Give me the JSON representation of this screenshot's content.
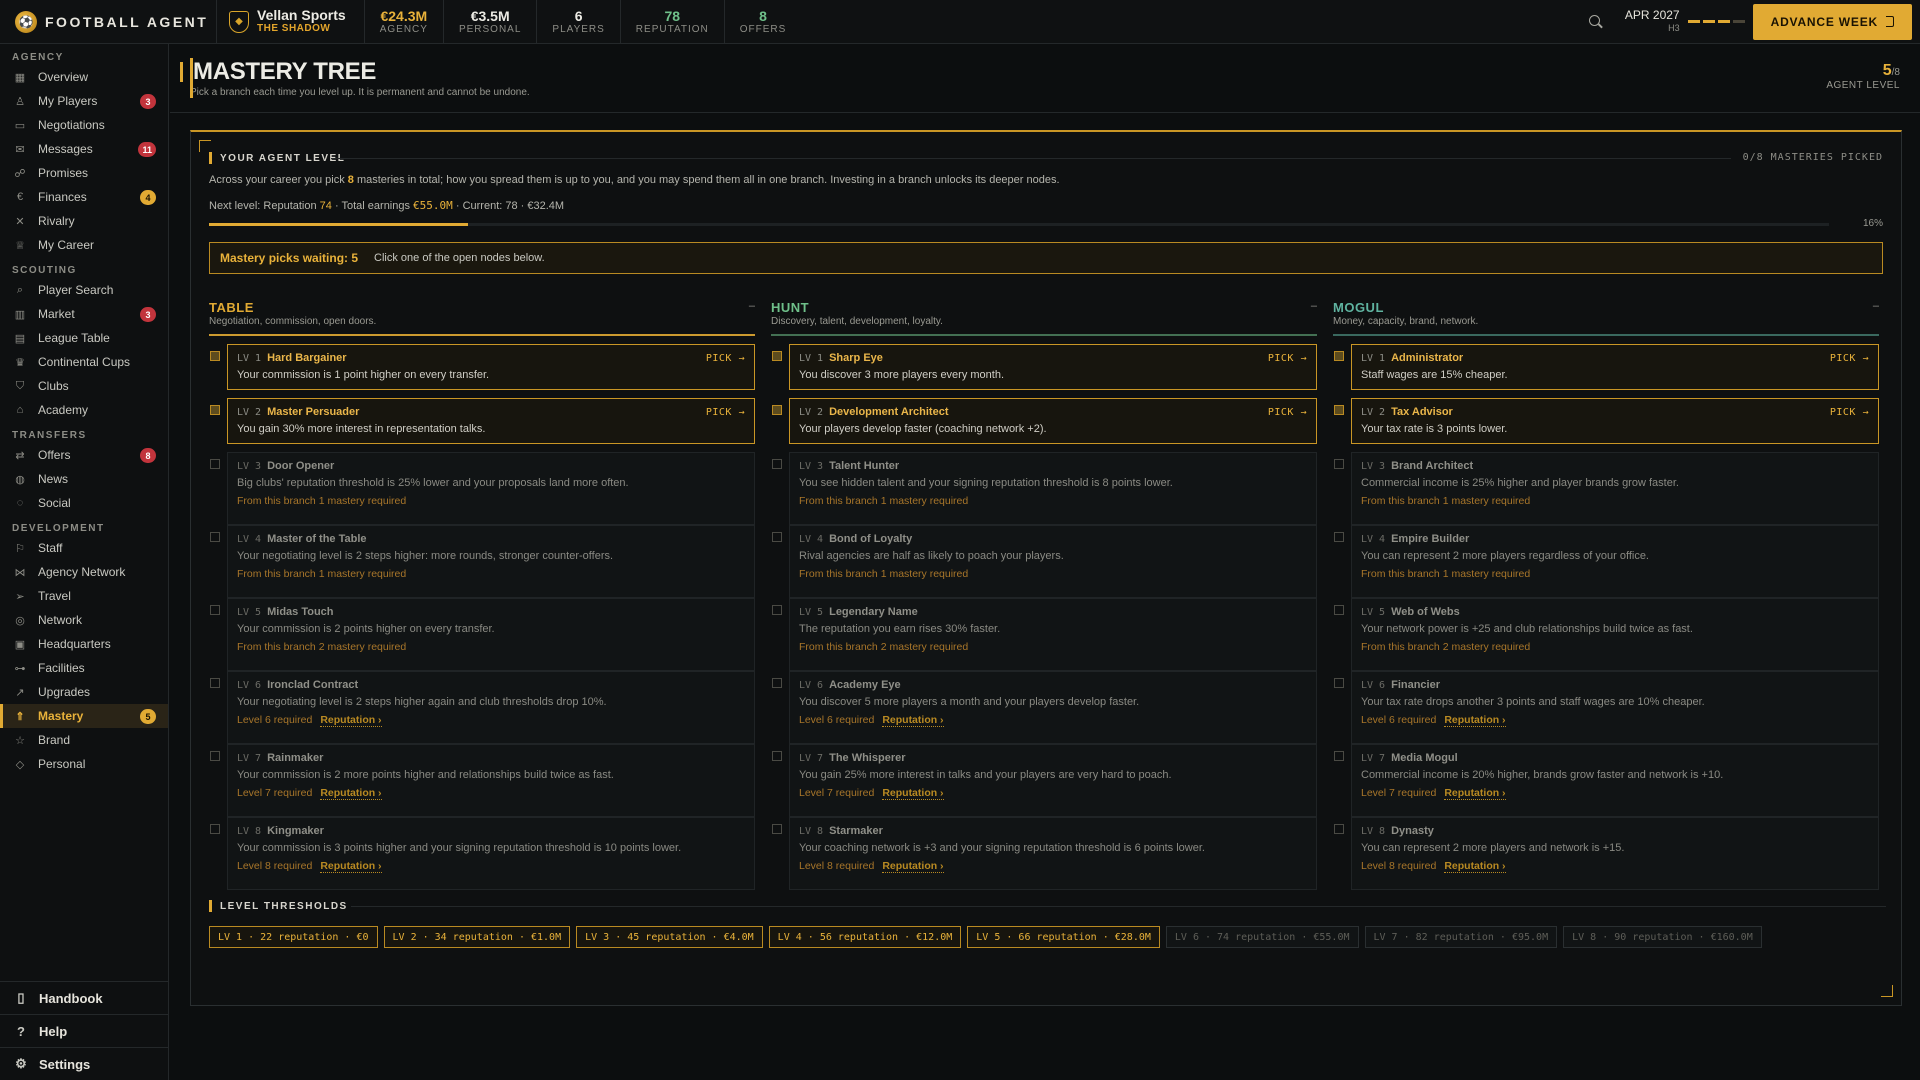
{
  "app": {
    "logo_mark": "⚽",
    "name": "FOOTBALL AGENT"
  },
  "club": {
    "name": "Vellan Sports",
    "subtitle": "THE SHADOW"
  },
  "stats": [
    {
      "value": "€24.3M",
      "label": "AGENCY",
      "color": "gold"
    },
    {
      "value": "€3.5M",
      "label": "PERSONAL",
      "color": "white"
    },
    {
      "value": "6",
      "label": "PLAYERS",
      "color": "white"
    },
    {
      "value": "78",
      "label": "REPUTATION",
      "color": "green"
    },
    {
      "value": "8",
      "label": "OFFERS",
      "color": "green"
    }
  ],
  "date": {
    "main": "APR 2027",
    "sub": "H3"
  },
  "advance_label": "ADVANCE WEEK",
  "sidebar": {
    "sections": [
      {
        "title": "AGENCY",
        "items": [
          {
            "label": "Overview",
            "icon": "grid-icon",
            "glyph": "▦"
          },
          {
            "label": "My Players",
            "icon": "user-icon",
            "glyph": "♙",
            "badge": "3"
          },
          {
            "label": "Negotiations",
            "icon": "chat-icon",
            "glyph": "▭"
          },
          {
            "label": "Messages",
            "icon": "mail-icon",
            "glyph": "✉",
            "badge": "11"
          },
          {
            "label": "Promises",
            "icon": "handshake-icon",
            "glyph": "☍"
          },
          {
            "label": "Finances",
            "icon": "euro-icon",
            "glyph": "€",
            "badge": "4",
            "badge_style": "y"
          },
          {
            "label": "Rivalry",
            "icon": "swords-icon",
            "glyph": "✕"
          },
          {
            "label": "My Career",
            "icon": "medal-icon",
            "glyph": "♕"
          }
        ]
      },
      {
        "title": "SCOUTING",
        "items": [
          {
            "label": "Player Search",
            "icon": "search-icon",
            "glyph": "⌕"
          },
          {
            "label": "Market",
            "icon": "bar-chart-icon",
            "glyph": "▥",
            "badge": "3"
          },
          {
            "label": "League Table",
            "icon": "table-icon",
            "glyph": "▤"
          },
          {
            "label": "Continental Cups",
            "icon": "trophy-icon",
            "glyph": "♛"
          },
          {
            "label": "Clubs",
            "icon": "shield-icon",
            "glyph": "⛉"
          },
          {
            "label": "Academy",
            "icon": "graduation-icon",
            "glyph": "⌂"
          }
        ]
      },
      {
        "title": "TRANSFERS",
        "items": [
          {
            "label": "Offers",
            "icon": "transfer-icon",
            "glyph": "⇄",
            "badge": "8"
          },
          {
            "label": "News",
            "icon": "globe-icon",
            "glyph": "◍"
          },
          {
            "label": "Social",
            "icon": "social-icon",
            "glyph": "◌"
          }
        ]
      },
      {
        "title": "DEVELOPMENT",
        "items": [
          {
            "label": "Staff",
            "icon": "whistle-icon",
            "glyph": "⚐"
          },
          {
            "label": "Agency Network",
            "icon": "network-icon",
            "glyph": "⋈"
          },
          {
            "label": "Travel",
            "icon": "plane-icon",
            "glyph": "➢"
          },
          {
            "label": "Network",
            "icon": "globe-icon",
            "glyph": "◎"
          },
          {
            "label": "Headquarters",
            "icon": "building-icon",
            "glyph": "▣"
          },
          {
            "label": "Facilities",
            "icon": "dumbbell-icon",
            "glyph": "⊶"
          },
          {
            "label": "Upgrades",
            "icon": "trend-up-icon",
            "glyph": "↗"
          },
          {
            "label": "Mastery",
            "icon": "chevrons-up-icon",
            "glyph": "⇑",
            "badge": "5",
            "badge_style": "y",
            "active": true
          },
          {
            "label": "Brand",
            "icon": "star-icon",
            "glyph": "☆"
          },
          {
            "label": "Personal",
            "icon": "gem-icon",
            "glyph": "◇"
          }
        ]
      }
    ],
    "bottom": [
      {
        "label": "Handbook",
        "icon": "book-icon",
        "glyph": "▯"
      },
      {
        "label": "Help",
        "icon": "help-icon",
        "glyph": "?"
      },
      {
        "label": "Settings",
        "icon": "gear-icon",
        "glyph": "⚙"
      }
    ]
  },
  "page": {
    "title": "MASTERY TREE",
    "subtitle": "Pick a branch each time you level up. It is permanent and cannot be undone.",
    "level_num": "5",
    "level_den": "/8",
    "level_label": "AGENT LEVEL"
  },
  "agent_level": {
    "heading": "YOUR AGENT LEVEL",
    "picked": "0/8 MASTERIES PICKED",
    "intro_a": "Across your career you pick ",
    "intro_b": "8",
    "intro_c": " masteries in total; how you spread them is up to you, and you may spend them all in one branch. Investing in a branch unlocks its deeper nodes.",
    "next_a": "Next level: Reputation ",
    "next_rep": "74",
    "next_b": " · Total earnings ",
    "next_money": "€55.0M",
    "next_c": " · Current: 78 · €32.4M",
    "progress": 0.16,
    "progress_label": "16%",
    "waiting_bold": "Mastery picks waiting: 5",
    "waiting_text": "Click one of the open nodes below."
  },
  "pick_label": "PICK →",
  "branches": [
    {
      "name": "TABLE",
      "desc": "Negotiation, commission, open doors.",
      "color": "#e1aa33",
      "dash": "–",
      "nodes": [
        {
          "lv": "LV 1",
          "name": "Hard Bargainer",
          "desc": "Your commission is 1 point higher on every transfer.",
          "open": true
        },
        {
          "lv": "LV 2",
          "name": "Master Persuader",
          "desc": "You gain 30% more interest in representation talks.",
          "open": true
        },
        {
          "lv": "LV 3",
          "name": "Door Opener",
          "desc": "Big clubs' reputation threshold is 25% lower and your proposals land more often.",
          "req": "From this branch 1 mastery required"
        },
        {
          "lv": "LV 4",
          "name": "Master of the Table",
          "desc": "Your negotiating level is 2 steps higher: more rounds, stronger counter-offers.",
          "req": "From this branch 1 mastery required"
        },
        {
          "lv": "LV 5",
          "name": "Midas Touch",
          "desc": "Your commission is 2 points higher on every transfer.",
          "req": "From this branch 2 mastery required"
        },
        {
          "lv": "LV 6",
          "name": "Ironclad Contract",
          "desc": "Your negotiating level is 2 steps higher again and club thresholds drop 10%.",
          "req": "Level 6 required",
          "link": "Reputation ›"
        },
        {
          "lv": "LV 7",
          "name": "Rainmaker",
          "desc": "Your commission is 2 more points higher and relationships build twice as fast.",
          "req": "Level 7 required",
          "link": "Reputation ›"
        },
        {
          "lv": "LV 8",
          "name": "Kingmaker",
          "desc": "Your commission is 3 points higher and your signing reputation threshold is 10 points lower.",
          "req": "Level 8 required",
          "link": "Reputation ›"
        }
      ]
    },
    {
      "name": "HUNT",
      "desc": "Discovery, talent, development, loyalty.",
      "color": "#6fc08a",
      "dash": "–",
      "nodes": [
        {
          "lv": "LV 1",
          "name": "Sharp Eye",
          "desc": "You discover 3 more players every month.",
          "open": true
        },
        {
          "lv": "LV 2",
          "name": "Development Architect",
          "desc": "Your players develop faster (coaching network +2).",
          "open": true
        },
        {
          "lv": "LV 3",
          "name": "Talent Hunter",
          "desc": "You see hidden talent and your signing reputation threshold is 8 points lower.",
          "req": "From this branch 1 mastery required"
        },
        {
          "lv": "LV 4",
          "name": "Bond of Loyalty",
          "desc": "Rival agencies are half as likely to poach your players.",
          "req": "From this branch 1 mastery required"
        },
        {
          "lv": "LV 5",
          "name": "Legendary Name",
          "desc": "The reputation you earn rises 30% faster.",
          "req": "From this branch 2 mastery required"
        },
        {
          "lv": "LV 6",
          "name": "Academy Eye",
          "desc": "You discover 5 more players a month and your players develop faster.",
          "req": "Level 6 required",
          "link": "Reputation ›"
        },
        {
          "lv": "LV 7",
          "name": "The Whisperer",
          "desc": "You gain 25% more interest in talks and your players are very hard to poach.",
          "req": "Level 7 required",
          "link": "Reputation ›"
        },
        {
          "lv": "LV 8",
          "name": "Starmaker",
          "desc": "Your coaching network is +3 and your signing reputation threshold is 6 points lower.",
          "req": "Level 8 required",
          "link": "Reputation ›"
        }
      ]
    },
    {
      "name": "MOGUL",
      "desc": "Money, capacity, brand, network.",
      "color": "#5fb3a0",
      "dash": "–",
      "nodes": [
        {
          "lv": "LV 1",
          "name": "Administrator",
          "desc": "Staff wages are 15% cheaper.",
          "open": true
        },
        {
          "lv": "LV 2",
          "name": "Tax Advisor",
          "desc": "Your tax rate is 3 points lower.",
          "open": true
        },
        {
          "lv": "LV 3",
          "name": "Brand Architect",
          "desc": "Commercial income is 25% higher and player brands grow faster.",
          "req": "From this branch 1 mastery required"
        },
        {
          "lv": "LV 4",
          "name": "Empire Builder",
          "desc": "You can represent 2 more players regardless of your office.",
          "req": "From this branch 1 mastery required"
        },
        {
          "lv": "LV 5",
          "name": "Web of Webs",
          "desc": "Your network power is +25 and club relationships build twice as fast.",
          "req": "From this branch 2 mastery required"
        },
        {
          "lv": "LV 6",
          "name": "Financier",
          "desc": "Your tax rate drops another 3 points and staff wages are 10% cheaper.",
          "req": "Level 6 required",
          "link": "Reputation ›"
        },
        {
          "lv": "LV 7",
          "name": "Media Mogul",
          "desc": "Commercial income is 20% higher, brands grow faster and network is +10.",
          "req": "Level 7 required",
          "link": "Reputation ›"
        },
        {
          "lv": "LV 8",
          "name": "Dynasty",
          "desc": "You can represent 2 more players and network is +15.",
          "req": "Level 8 required",
          "link": "Reputation ›"
        }
      ]
    }
  ],
  "thresholds": {
    "heading": "LEVEL THRESHOLDS",
    "items": [
      {
        "text": "LV 1 · 22 reputation · €0",
        "reached": true
      },
      {
        "text": "LV 2 · 34 reputation · €1.0M",
        "reached": true
      },
      {
        "text": "LV 3 · 45 reputation · €4.0M",
        "reached": true
      },
      {
        "text": "LV 4 · 56 reputation · €12.0M",
        "reached": true
      },
      {
        "text": "LV 5 · 66 reputation · €28.0M",
        "reached": true
      },
      {
        "text": "LV 6 · 74 reputation · €55.0M",
        "reached": false
      },
      {
        "text": "LV 7 · 82 reputation · €95.0M",
        "reached": false
      },
      {
        "text": "LV 8 · 90 reputation · €160.0M",
        "reached": false
      }
    ]
  }
}
